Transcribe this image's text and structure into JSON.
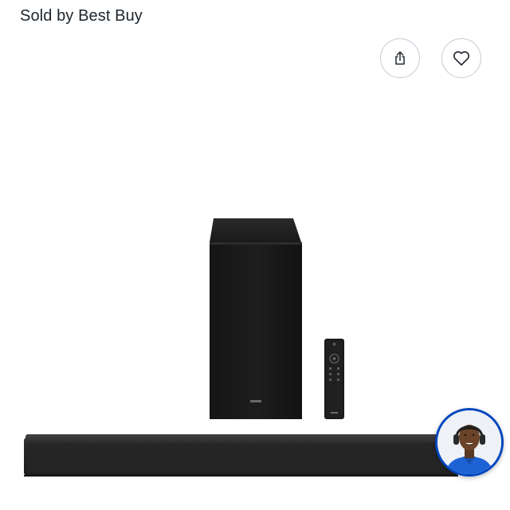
{
  "seller": {
    "label": "Sold by Best Buy"
  },
  "actions": {
    "share_icon": "share-icon",
    "favorite_icon": "heart-icon"
  },
  "product": {
    "image_subject": "soundbar-with-subwoofer-and-remote",
    "brand_mark": "SAMSUNG"
  },
  "chat": {
    "avatar_icon": "agent-avatar-icon",
    "ring_color": "#0046be"
  },
  "colors": {
    "text": "#1d252c",
    "border": "#c5cbd5",
    "accent": "#0046be"
  }
}
